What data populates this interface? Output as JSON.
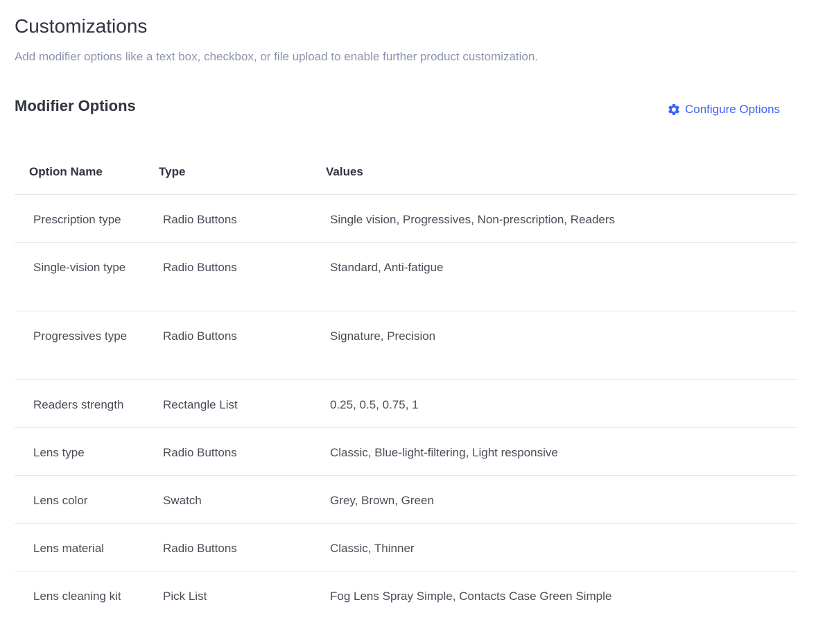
{
  "header": {
    "title": "Customizations",
    "description": "Add modifier options like a text box, checkbox, or file upload to enable further product customization."
  },
  "section": {
    "title": "Modifier Options",
    "configure_label": "Configure Options",
    "configure_icon": "gear-icon"
  },
  "colors": {
    "accent": "#3c64f4",
    "muted_text": "#8c93ad",
    "divider": "#e5e7ee"
  },
  "table": {
    "columns": [
      "Option Name",
      "Type",
      "Values"
    ],
    "rows": [
      {
        "name": "Prescription type",
        "type": "Radio Buttons",
        "values": "Single vision, Progressives, Non-prescription, Readers"
      },
      {
        "name": "Single-vision type",
        "type": "Radio Buttons",
        "values": "Standard, Anti-fatigue"
      },
      {
        "name": "Progressives type",
        "type": "Radio Buttons",
        "values": "Signature, Precision"
      },
      {
        "name": "Readers strength",
        "type": "Rectangle List",
        "values": "0.25, 0.5, 0.75, 1"
      },
      {
        "name": "Lens type",
        "type": "Radio Buttons",
        "values": "Classic, Blue-light-filtering, Light responsive"
      },
      {
        "name": "Lens color",
        "type": "Swatch",
        "values": "Grey, Brown, Green"
      },
      {
        "name": "Lens material",
        "type": "Radio Buttons",
        "values": "Classic, Thinner"
      },
      {
        "name": "Lens cleaning kit",
        "type": "Pick List",
        "values": "Fog Lens Spray Simple, Contacts Case Green Simple"
      }
    ]
  }
}
